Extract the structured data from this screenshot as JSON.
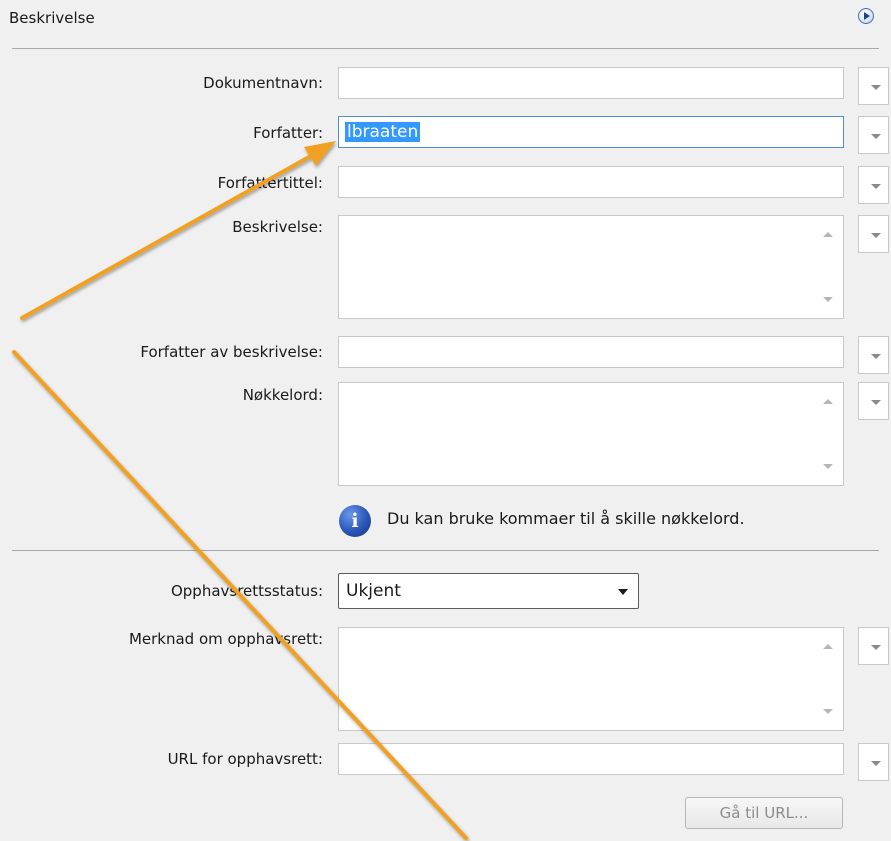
{
  "section": {
    "title": "Beskrivelse"
  },
  "fields": {
    "document_name": {
      "label": "Dokumentnavn:",
      "value": ""
    },
    "author": {
      "label": "Forfatter:",
      "value": "lbraaten"
    },
    "author_title": {
      "label": "Forfattertittel:",
      "value": ""
    },
    "description": {
      "label": "Beskrivelse:",
      "value": ""
    },
    "description_author": {
      "label": "Forfatter av beskrivelse:",
      "value": ""
    },
    "keywords": {
      "label": "Nøkkelord:",
      "value": "",
      "hint": "Du kan bruke kommaer til å skille nøkkelord."
    },
    "copyright_status": {
      "label": "Opphavsrettsstatus:",
      "value": "Ukjent"
    },
    "copyright_notice": {
      "label": "Merknad om opphavsrett:",
      "value": ""
    },
    "copyright_url": {
      "label": "URL for opphavsrett:",
      "value": "",
      "button": "Gå til URL..."
    }
  },
  "icons": {
    "expand": "expand-arrow-icon",
    "info": "info-icon",
    "dropdown": "chevron-down-icon"
  },
  "colors": {
    "selection": "#3399ff",
    "annotation_arrow": "#f0a020",
    "info_blue": "#2a57b8"
  }
}
